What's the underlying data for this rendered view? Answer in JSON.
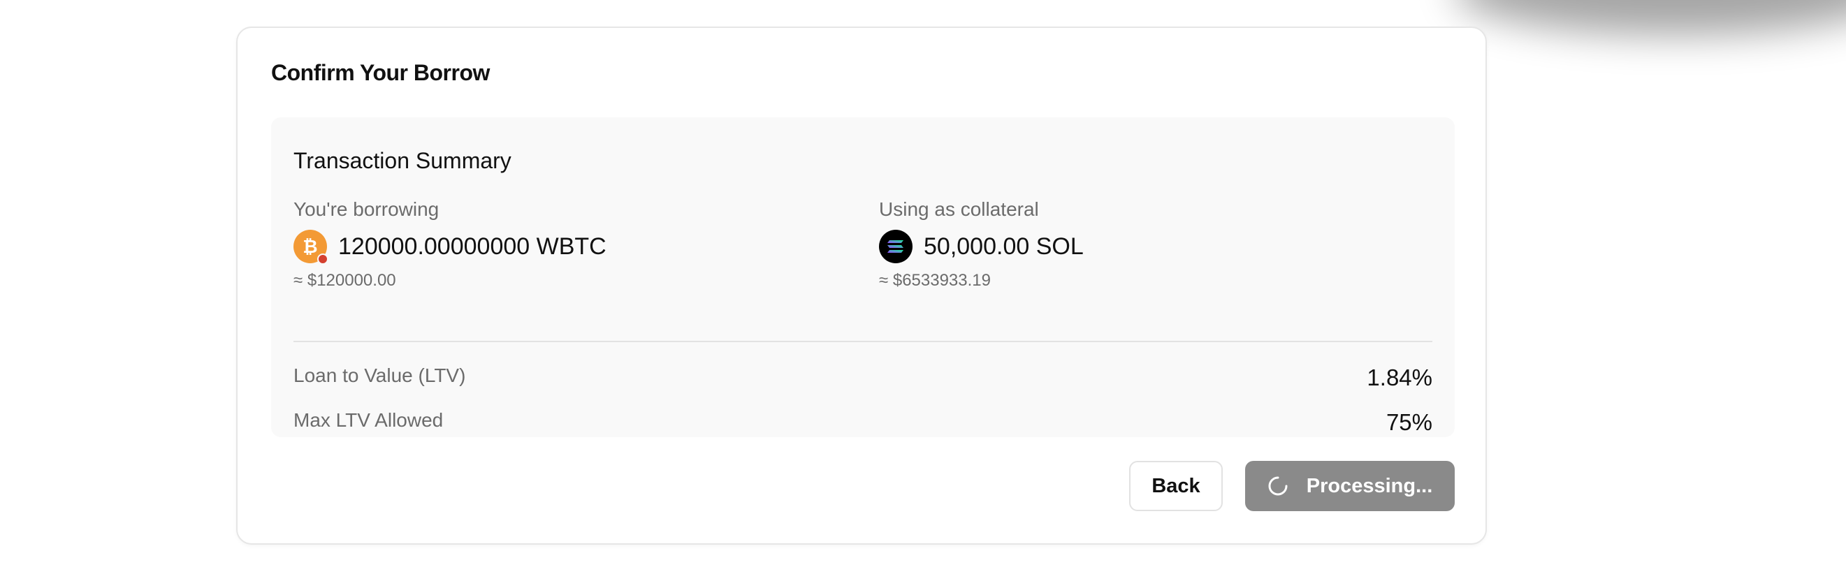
{
  "card": {
    "title": "Confirm Your Borrow"
  },
  "summary": {
    "title": "Transaction Summary",
    "borrowing": {
      "label": "You're borrowing",
      "amount": "120000.00000000 WBTC",
      "usd": "≈ $120000.00",
      "icon": "bitcoin-icon"
    },
    "collateral": {
      "label": "Using as collateral",
      "amount": "50,000.00 SOL",
      "usd": "≈ $6533933.19",
      "icon": "solana-icon"
    },
    "ltv": {
      "label": "Loan to Value (LTV)",
      "value": "1.84%"
    },
    "max_ltv": {
      "label": "Max LTV Allowed",
      "value": "75%"
    }
  },
  "actions": {
    "back_label": "Back",
    "processing_label": "Processing..."
  },
  "colors": {
    "btc": "#f39a35",
    "sol_bg": "#000000",
    "processing_bg": "#8a8a8a",
    "summary_bg": "#f9f9f9"
  }
}
